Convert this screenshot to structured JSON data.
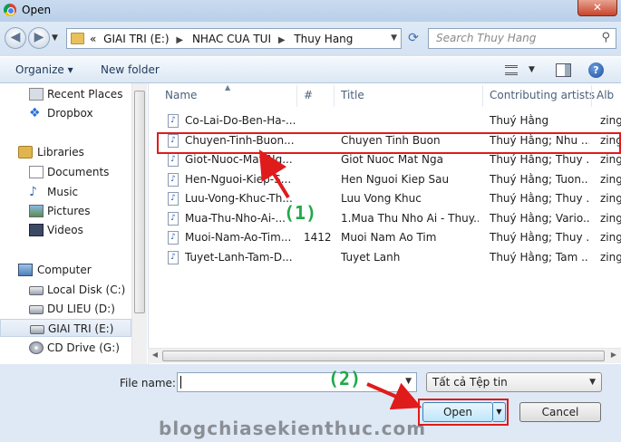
{
  "window": {
    "title": "Open",
    "close_glyph": "✕"
  },
  "nav": {
    "back_glyph": "◀",
    "forward_glyph": "▶",
    "dropdown_glyph": "▼",
    "breadcrumb": [
      "«",
      "GIAI TRI (E:)",
      "NHAC CUA TUI",
      "Thuy Hang"
    ],
    "crumb_separator": "▶",
    "refresh_glyph": "⟳",
    "search_placeholder": "Search Thuy Hang",
    "search_glyph": "⚲"
  },
  "toolbar": {
    "organize_label": "Organize ▾",
    "new_folder_label": "New folder",
    "help_glyph": "?"
  },
  "sidebar": {
    "items": [
      {
        "label": "Recent Places",
        "icon": "recent-places-icon",
        "group": false
      },
      {
        "label": "Dropbox",
        "icon": "dropbox-icon",
        "group": false,
        "glyph": "❖"
      },
      {
        "label": "Libraries",
        "icon": "libraries-icon",
        "group": true
      },
      {
        "label": "Documents",
        "icon": "documents-icon",
        "group": false
      },
      {
        "label": "Music",
        "icon": "music-icon",
        "group": false,
        "glyph": "♪"
      },
      {
        "label": "Pictures",
        "icon": "pictures-icon",
        "group": false
      },
      {
        "label": "Videos",
        "icon": "videos-icon",
        "group": false
      },
      {
        "label": "Computer",
        "icon": "computer-icon",
        "group": true
      },
      {
        "label": "Local Disk (C:)",
        "icon": "local-disk-icon",
        "group": false
      },
      {
        "label": "DU LIEU (D:)",
        "icon": "drive-icon",
        "group": false
      },
      {
        "label": "GIAI TRI (E:)",
        "icon": "drive-icon",
        "group": false,
        "selected": true
      },
      {
        "label": "CD Drive (G:)",
        "icon": "cd-drive-icon",
        "group": false
      }
    ]
  },
  "table": {
    "columns": [
      "Name",
      "#",
      "Title",
      "Contributing artists",
      "Album"
    ],
    "column_album_visible": "Alb",
    "sort_glyph": "▲",
    "file_glyph": "♪",
    "rows": [
      {
        "name": "Co-Lai-Do-Ben-Ha-...",
        "num": "",
        "title": "",
        "artists": "Thuý Hằng",
        "album": "zing"
      },
      {
        "name": "Chuyen-Tinh-Buon...",
        "num": "",
        "title": "Chuyen Tinh Buon",
        "artists": "Thuý Hằng; Nhu ...",
        "album": "zing"
      },
      {
        "name": "Giot-Nuoc-Mat-Ng...",
        "num": "",
        "title": "Giot Nuoc Mat Nga",
        "artists": "Thuý Hằng; Thuy ...",
        "album": "zing"
      },
      {
        "name": "Hen-Nguoi-Kiep-S...",
        "num": "",
        "title": "Hen Nguoi Kiep Sau",
        "artists": "Thuý Hằng; Tuon...",
        "album": "zing"
      },
      {
        "name": "Luu-Vong-Khuc-Th...",
        "num": "",
        "title": "Luu Vong Khuc",
        "artists": "Thuý Hằng; Thuy ...",
        "album": "zing"
      },
      {
        "name": "Mua-Thu-Nho-Ai-...",
        "num": "",
        "title": "1.Mua Thu Nho Ai - Thuy...",
        "artists": "Thuý Hằng; Vario...",
        "album": "zing"
      },
      {
        "name": "Muoi-Nam-Ao-Tim...",
        "num": "1412",
        "title": "Muoi Nam Ao Tim",
        "artists": "Thuý Hằng; Thuy ...",
        "album": "zing"
      },
      {
        "name": "Tuyet-Lanh-Tam-D...",
        "num": "",
        "title": "Tuyet Lanh",
        "artists": "Thuý Hằng; Tam ...",
        "album": "zing"
      }
    ],
    "highlighted_row": 1
  },
  "footer": {
    "filename_label": "File name:",
    "filename_value": "",
    "filter_value": "Tất cả Tệp tin",
    "open_label": "Open",
    "open_split_glyph": "▼",
    "cancel_label": "Cancel"
  },
  "annotations": {
    "step1": "(1)",
    "step2": "(2)",
    "color": "#22a84a",
    "arrow_color": "#e01b1b"
  },
  "watermark": "blogchiasekienthuc.com"
}
